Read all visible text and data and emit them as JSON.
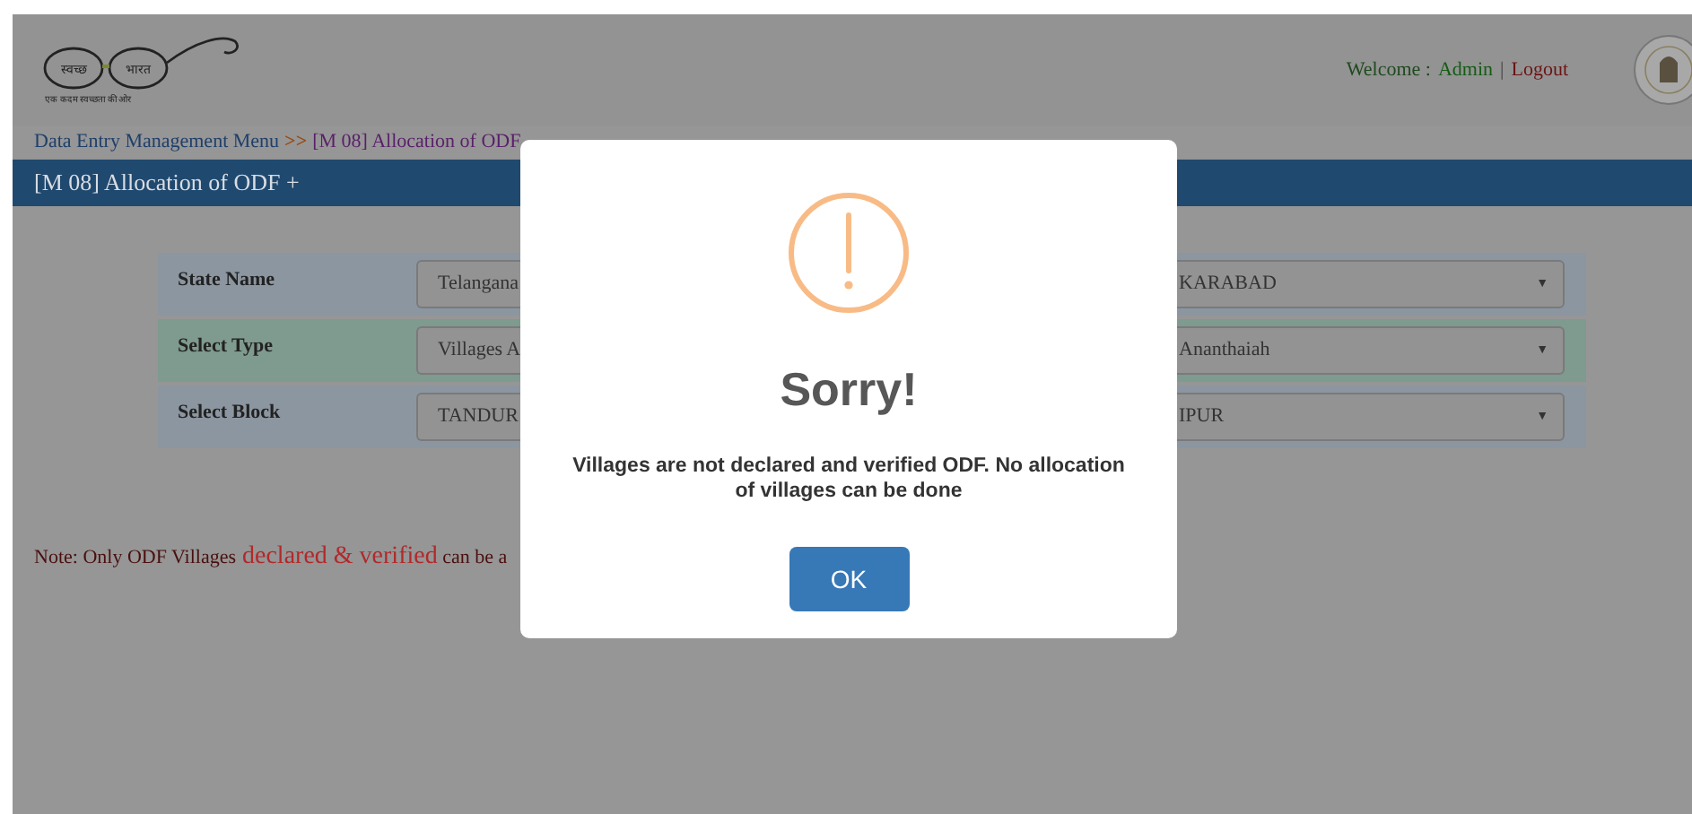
{
  "header": {
    "logo": {
      "word_left": "स्वच्छ",
      "word_right": "भारत",
      "tagline": "एक कदम स्वच्छता की ओर"
    },
    "welcome_label": "Welcome :",
    "user": "Admin",
    "separator": "|",
    "logout": "Logout"
  },
  "breadcrumb": [
    {
      "text": "Data Entry Management Menu",
      "kind": "link"
    },
    {
      "text": ">>",
      "kind": "separator"
    },
    {
      "text": "[M 08] Allocation of ODF",
      "kind": "current"
    }
  ],
  "page_title": "[M 08] Allocation of ODF +",
  "form_rows": [
    {
      "label": "State Name",
      "value": "Telangana",
      "value_2": "KARABAD",
      "highlighted": false
    },
    {
      "label": "Select Type",
      "value": "Villages A",
      "value_2": "Ananthaiah",
      "highlighted": true
    },
    {
      "label": "Select Block",
      "value": "TANDUR",
      "value_2": "IPUR",
      "highlighted": false
    }
  ],
  "dropdown_arrow": "▼",
  "note": [
    {
      "text": "Note: Only ODF Villages",
      "emphasis": false
    },
    {
      "text": "declared & verified",
      "emphasis": true
    },
    {
      "text": "can be a",
      "emphasis": false
    }
  ],
  "dialog": {
    "title": "Sorry!",
    "message": "Villages are not declared and verified ODF. No allocation of villages can be done",
    "button": "OK"
  }
}
